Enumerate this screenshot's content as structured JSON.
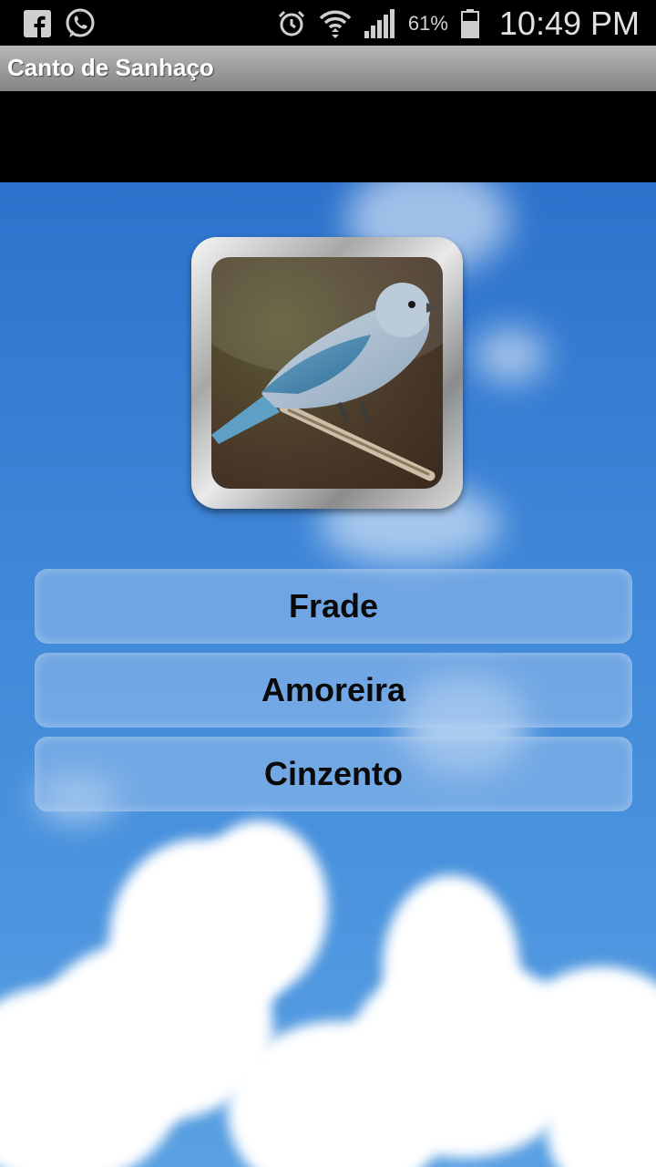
{
  "status_bar": {
    "icons": [
      "facebook-icon",
      "whatsapp-icon",
      "alarm-icon",
      "wifi-icon",
      "signal-icon",
      "battery-icon"
    ],
    "battery_percent": "61%",
    "time": "10:49 PM"
  },
  "action_bar": {
    "title": "Canto de Sanhaço"
  },
  "main": {
    "image": "bird-photo",
    "buttons": [
      {
        "label": "Frade"
      },
      {
        "label": "Amoreira"
      },
      {
        "label": "Cinzento"
      }
    ]
  },
  "colors": {
    "sky": "#3f87d8",
    "button_fill": "#96beeb",
    "action_bar": "#9a9a9a"
  }
}
